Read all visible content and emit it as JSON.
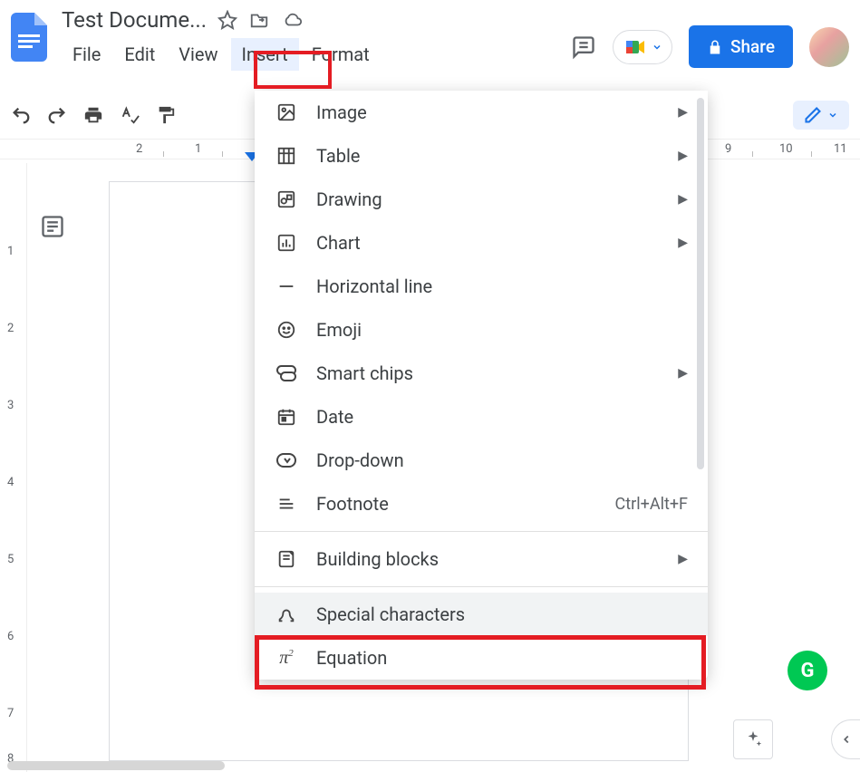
{
  "doc": {
    "title": "Test Docume..."
  },
  "menubar": {
    "file": "File",
    "edit": "Edit",
    "view": "View",
    "insert": "Insert",
    "format": "Format"
  },
  "share": {
    "label": "Share"
  },
  "insert_menu": {
    "image": "Image",
    "table": "Table",
    "drawing": "Drawing",
    "chart": "Chart",
    "hline": "Horizontal line",
    "emoji": "Emoji",
    "smartchips": "Smart chips",
    "date": "Date",
    "dropdown": "Drop-down",
    "footnote": "Footnote",
    "footnote_shortcut": "Ctrl+Alt+F",
    "building": "Building blocks",
    "special": "Special characters",
    "equation": "Equation"
  },
  "ruler": {
    "n2": "2",
    "n1": "1",
    "n9": "9",
    "n10": "10",
    "n11": "11"
  },
  "vruler": {
    "n1": "1",
    "n2": "2",
    "n3": "3",
    "n4": "4",
    "n5": "5",
    "n6": "6",
    "n7": "7",
    "n8": "8"
  },
  "grammarly": {
    "letter": "G"
  }
}
